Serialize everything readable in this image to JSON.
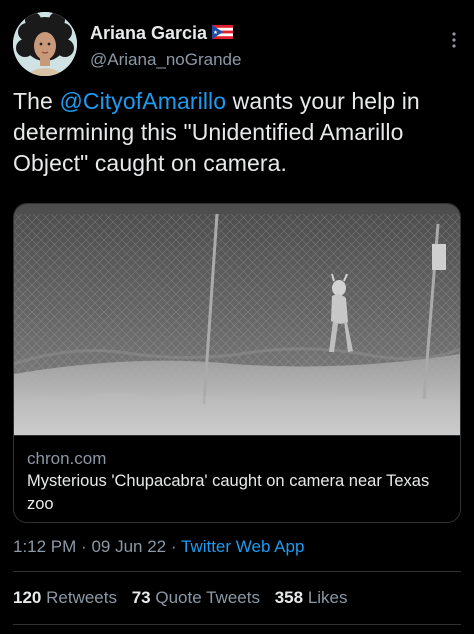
{
  "author": {
    "display_name": "Ariana Garcia",
    "handle": "@Ariana_noGrande",
    "flag_icon": "puerto-rico-flag-icon",
    "avatar_icon": "cartoon-avatar-curly-hair"
  },
  "tweet": {
    "text_before": "The ",
    "mention": "@CityofAmarillo",
    "text_after": " wants your help in determining this \"Unidentified Amarillo Object\" caught on camera."
  },
  "card": {
    "domain": "chron.com",
    "title": "Mysterious 'Chupacabra' caught on camera near Texas zoo"
  },
  "meta": {
    "time": "1:12 PM",
    "date": "09 Jun 22",
    "separator": "·",
    "source": "Twitter Web App"
  },
  "stats": {
    "retweets_count": "120",
    "retweets_label": "Retweets",
    "quotes_count": "73",
    "quotes_label": "Quote Tweets",
    "likes_count": "358",
    "likes_label": "Likes"
  },
  "colors": {
    "background": "#000000",
    "text": "#e7e9ea",
    "secondary": "#8b98a5",
    "accent": "#1d9bf0",
    "divider": "#2f3336"
  }
}
